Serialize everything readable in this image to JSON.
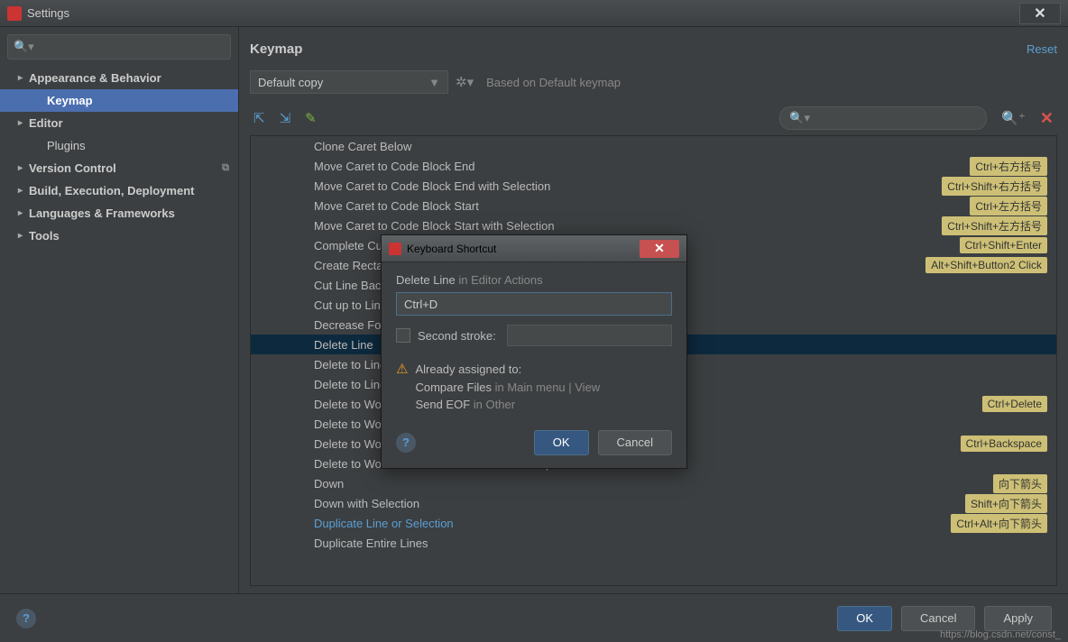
{
  "window": {
    "title": "Settings"
  },
  "sidebar": {
    "items": [
      {
        "label": "Appearance & Behavior",
        "bold": true,
        "arrow": true
      },
      {
        "label": "Keymap",
        "bold": true,
        "selected": true,
        "l2": true
      },
      {
        "label": "Editor",
        "bold": true,
        "arrow": true
      },
      {
        "label": "Plugins",
        "l2": true
      },
      {
        "label": "Version Control",
        "bold": true,
        "arrow": true,
        "copy": true
      },
      {
        "label": "Build, Execution, Deployment",
        "bold": true,
        "arrow": true
      },
      {
        "label": "Languages & Frameworks",
        "bold": true,
        "arrow": true
      },
      {
        "label": "Tools",
        "bold": true,
        "arrow": true
      }
    ]
  },
  "header": {
    "title": "Keymap",
    "reset": "Reset"
  },
  "keymap": {
    "selected": "Default copy",
    "based_on": "Based on Default keymap"
  },
  "actions": [
    {
      "label": "Clone Caret Below"
    },
    {
      "label": "Move Caret to Code Block End",
      "shortcut": "Ctrl+右方括号"
    },
    {
      "label": "Move Caret to Code Block End with Selection",
      "shortcut": "Ctrl+Shift+右方括号"
    },
    {
      "label": "Move Caret to Code Block Start",
      "shortcut": "Ctrl+左方括号"
    },
    {
      "label": "Move Caret to Code Block Start with Selection",
      "shortcut": "Ctrl+Shift+左方括号"
    },
    {
      "label": "Complete Current Statement",
      "shortcut": "Ctrl+Shift+Enter"
    },
    {
      "label": "Create Rectangular Selection",
      "shortcut": "Alt+Shift+Button2 Click"
    },
    {
      "label": "Cut Line Backward"
    },
    {
      "label": "Cut up to Line End"
    },
    {
      "label": "Decrease Font Size"
    },
    {
      "label": "Delete Line",
      "selected": true
    },
    {
      "label": "Delete to Line End"
    },
    {
      "label": "Delete to Line Start"
    },
    {
      "label": "Delete to Word End",
      "shortcut": "Ctrl+Delete"
    },
    {
      "label": "Delete to Word End in Different \"CamelHumps\" Mode"
    },
    {
      "label": "Delete to Word Start",
      "shortcut": "Ctrl+Backspace"
    },
    {
      "label": "Delete to Word Start in Different \"CamelHumps\" Mode"
    },
    {
      "label": "Down",
      "shortcut": "向下箭头"
    },
    {
      "label": "Down with Selection",
      "shortcut": "Shift+向下箭头"
    },
    {
      "label": "Duplicate Line or Selection",
      "hl": true,
      "shortcut": "Ctrl+Alt+向下箭头"
    },
    {
      "label": "Duplicate Entire Lines"
    }
  ],
  "dialog": {
    "title": "Keyboard Shortcut",
    "action": "Delete Line",
    "context": "in Editor Actions",
    "value": "Ctrl+D",
    "second_label": "Second stroke:",
    "warn_title": "Already assigned to:",
    "warn1a": "Compare Files",
    "warn1b": "in Main menu | View",
    "warn2a": "Send EOF",
    "warn2b": "in Other",
    "ok": "OK",
    "cancel": "Cancel"
  },
  "footer": {
    "ok": "OK",
    "cancel": "Cancel",
    "apply": "Apply"
  },
  "watermark": "https://blog.csdn.net/const_"
}
